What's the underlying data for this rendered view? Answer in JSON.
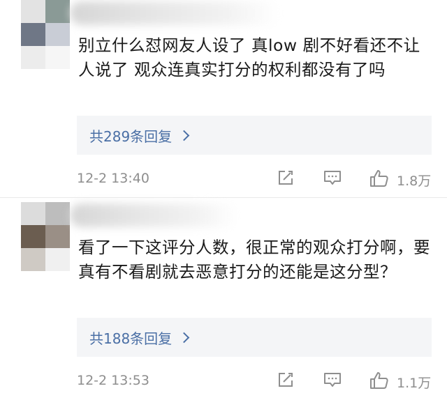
{
  "comments": [
    {
      "text": "别立什么怼网友人设了 真low 剧不好看还不让人说了 观众连真实打分的权利都没有了吗",
      "replies_label": "共289条回复",
      "time": "12-2 13:40",
      "likes": "1.8万"
    },
    {
      "text": "看了一下这评分人数，很正常的观众打分啊，要真有不看剧就去恶意打分的还能是这分型？",
      "replies_label": "共188条回复",
      "time": "12-2 13:53",
      "likes": "1.1万"
    }
  ],
  "icons": {
    "edit": "edit-icon",
    "comment": "comment-icon",
    "like": "thumbs-up-icon",
    "chevron": "chevron-right-icon"
  },
  "colors": {
    "link": "#4a6fa5",
    "meta": "#8e8e8e",
    "reply_bg": "#f4f5f7"
  }
}
